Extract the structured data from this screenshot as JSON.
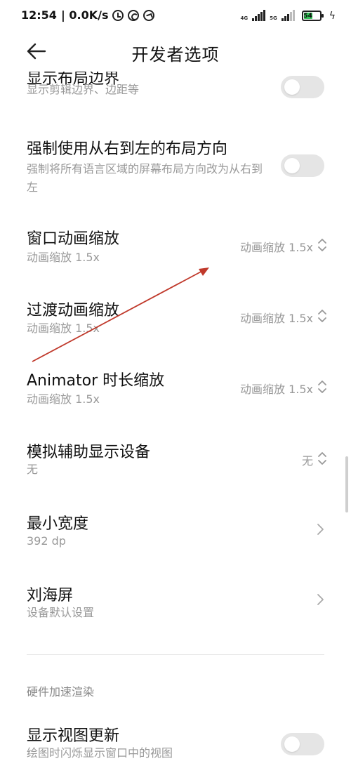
{
  "status_bar": {
    "time": "12:54",
    "speed": "| 0.0K/s",
    "net1": "4G",
    "net2": "5G",
    "battery": "54",
    "icons": [
      "alarm-icon",
      "sync-icon",
      "navigation-icon",
      "signal-icon",
      "battery-icon",
      "charging-icon"
    ]
  },
  "header": {
    "title": "开发者选项",
    "back_icon": "arrow-left-icon"
  },
  "items": {
    "layout_bounds": {
      "title": "显示布局边界",
      "subtitle": "显示剪辑边界、边距等",
      "checked": false
    },
    "force_rtl": {
      "title": "强制使用从右到左的布局方向",
      "subtitle": "强制将所有语言区域的屏幕布局方向改为从右到左",
      "checked": false
    },
    "window_anim": {
      "title": "窗口动画缩放",
      "subtitle": "动画缩放 1.5x",
      "value": "动画缩放 1.5x"
    },
    "transition_anim": {
      "title": "过渡动画缩放",
      "subtitle": "动画缩放 1.5x",
      "value": "动画缩放 1.5x"
    },
    "animator_duration": {
      "title": "Animator 时长缩放",
      "subtitle": "动画缩放 1.5x",
      "value": "动画缩放 1.5x"
    },
    "simulate_display": {
      "title": "模拟辅助显示设备",
      "subtitle": "无",
      "value": "无"
    },
    "smallest_width": {
      "title": "最小宽度",
      "subtitle": "392 dp"
    },
    "notch": {
      "title": "刘海屏",
      "subtitle": "设备默认设置"
    },
    "section_hw": {
      "label": "硬件加速渲染"
    },
    "show_view_updates": {
      "title": "显示视图更新",
      "subtitle": "绘图时闪烁显示窗口中的视图",
      "checked": false
    }
  },
  "colors": {
    "annotation_arrow": "#c0392b",
    "toggle_off": "#e5e5e5",
    "battery": "#34c759"
  }
}
